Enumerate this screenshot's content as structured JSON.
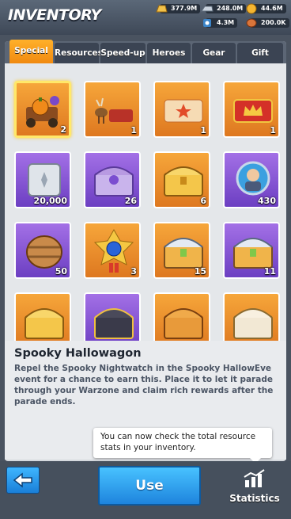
{
  "header": {
    "title": "INVENTORY",
    "resources": [
      {
        "icon": "gold-bar-icon",
        "value": "377.9M"
      },
      {
        "icon": "iron-icon",
        "value": "248.0M"
      },
      {
        "icon": "coin-icon",
        "value": "44.6M"
      },
      {
        "icon": "gear-resource-icon",
        "value": "4.3M"
      },
      {
        "icon": "food-icon",
        "value": "200.0K"
      }
    ]
  },
  "tabs": [
    {
      "label": "Special",
      "active": true
    },
    {
      "label": "Resources",
      "active": false
    },
    {
      "label": "Speed-up",
      "active": false
    },
    {
      "label": "Heroes",
      "active": false
    },
    {
      "label": "Gear",
      "active": false
    },
    {
      "label": "Gift",
      "active": false
    }
  ],
  "items": [
    {
      "icon": "hallowagon-icon",
      "qty": "2",
      "bg": "orange",
      "selected": true
    },
    {
      "icon": "reindeer-sleigh-icon",
      "qty": "1",
      "bg": "orange",
      "selected": false
    },
    {
      "icon": "star-ticket-icon",
      "qty": "1",
      "bg": "orange",
      "selected": false
    },
    {
      "icon": "crown-ticket-icon",
      "qty": "1",
      "bg": "orange",
      "selected": false
    },
    {
      "icon": "silver-safe-icon",
      "qty": "20,000",
      "bg": "purple",
      "selected": false
    },
    {
      "icon": "purple-chest-icon",
      "qty": "26",
      "bg": "purple",
      "selected": false
    },
    {
      "icon": "gold-chest-icon",
      "qty": "6",
      "bg": "orange",
      "selected": false
    },
    {
      "icon": "hero-portrait-icon",
      "qty": "430",
      "bg": "purple",
      "selected": false
    },
    {
      "icon": "barrel-icon",
      "qty": "50",
      "bg": "purple",
      "selected": false
    },
    {
      "icon": "blue-gem-medal-icon",
      "qty": "3",
      "bg": "orange",
      "selected": false
    },
    {
      "icon": "steel-chest-icon",
      "qty": "15",
      "bg": "orange",
      "selected": false
    },
    {
      "icon": "steel-chest-icon",
      "qty": "11",
      "bg": "purple",
      "selected": false
    },
    {
      "icon": "gold-chest-icon",
      "qty": "",
      "bg": "orange",
      "selected": false
    },
    {
      "icon": "dark-chest-icon",
      "qty": "",
      "bg": "purple",
      "selected": false
    },
    {
      "icon": "wood-chest-icon",
      "qty": "",
      "bg": "orange",
      "selected": false
    },
    {
      "icon": "ivory-chest-icon",
      "qty": "",
      "bg": "orange",
      "selected": false
    }
  ],
  "detail": {
    "title": "Spooky Hallowagon",
    "text": "Repel the Spooky Nightwatch in the Spooky HallowEve event for a chance to earn this. Place it to let it parade through your Warzone and claim rich rewards after the parade ends."
  },
  "tooltip": {
    "text": "You can now check the total resource stats in your inventory."
  },
  "bottom": {
    "use_label": "Use",
    "stats_label": "Statistics",
    "back_icon": "back-arrow-icon"
  },
  "colors": {
    "tab_active": "#f59a1c",
    "cell_orange": "#ee902c",
    "cell_purple": "#8b58d6",
    "button_blue": "#2f9ff0"
  }
}
